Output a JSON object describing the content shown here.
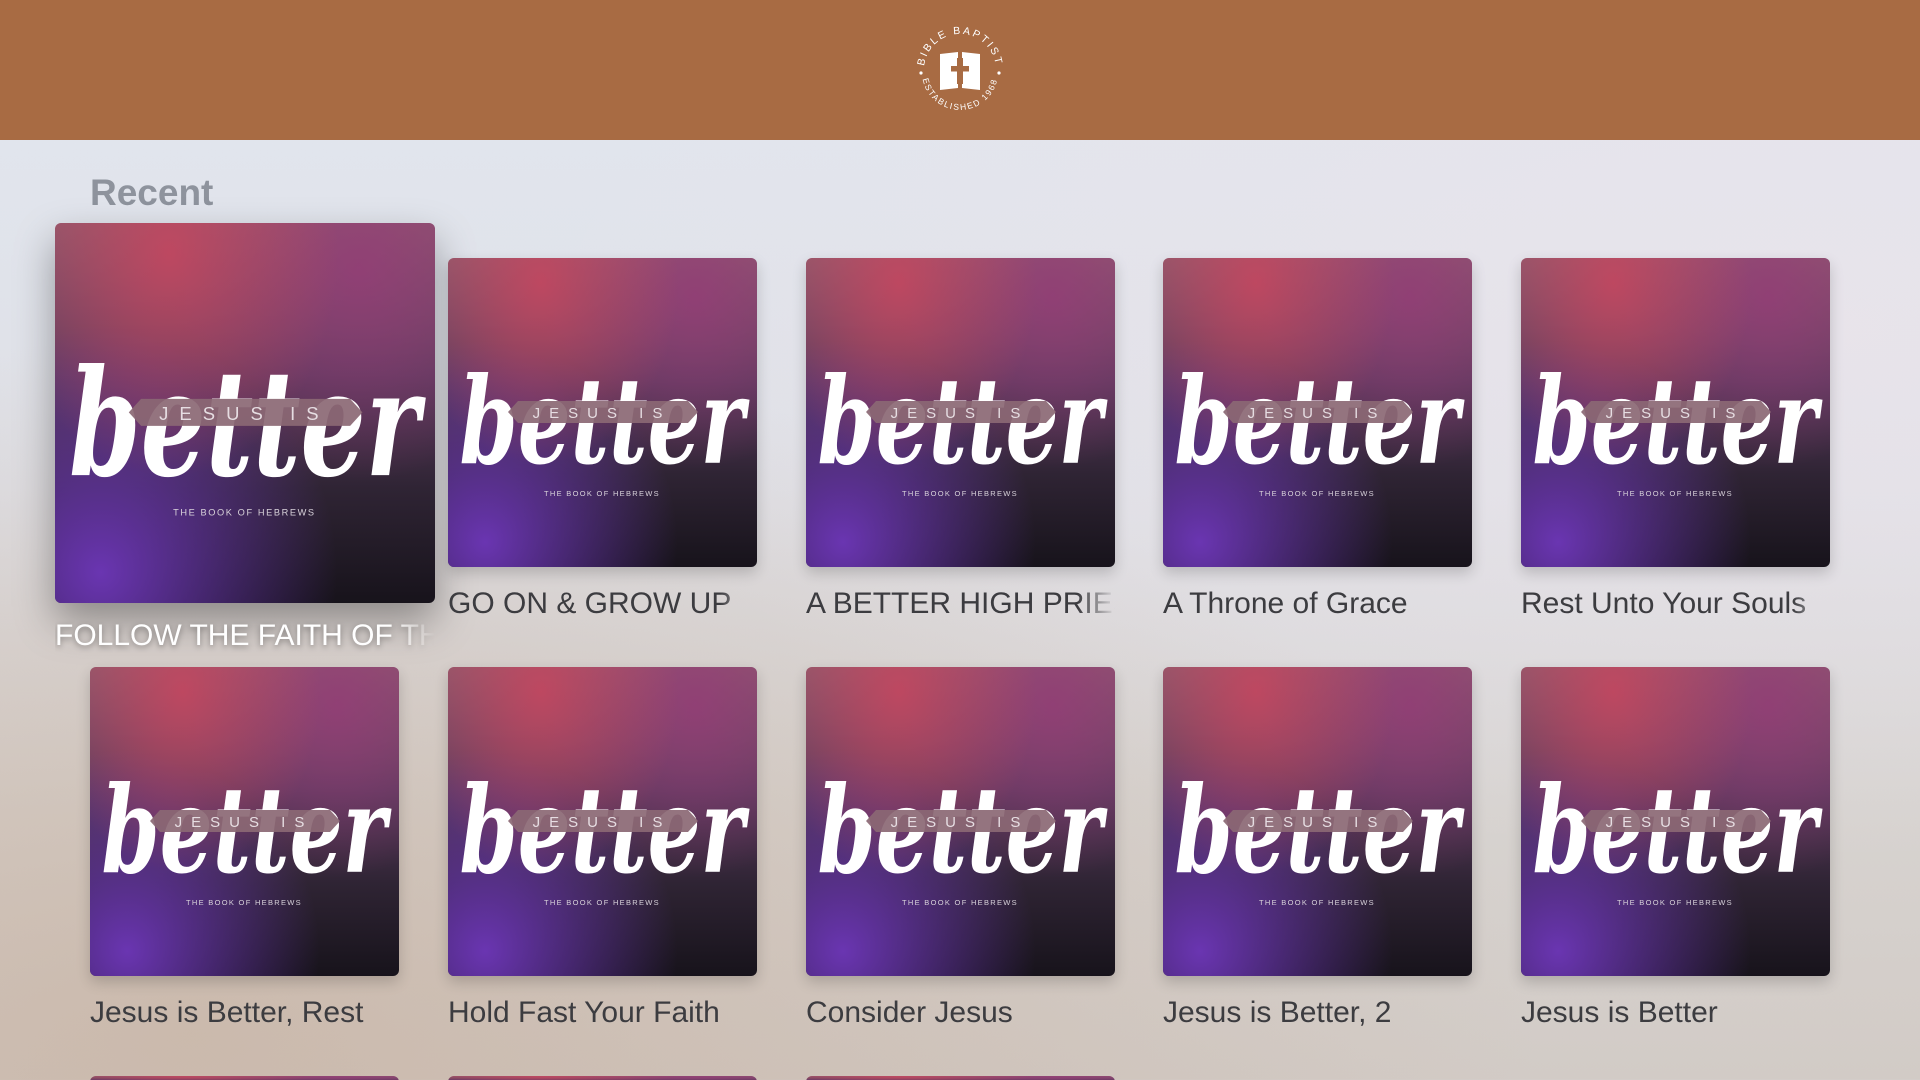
{
  "header": {
    "logo": {
      "icon": "bible-icon",
      "ring_top_text": "BIBLE BAPTIST",
      "ring_bottom_text": "ESTABLISHED 1968"
    },
    "background_color": "#a86b43"
  },
  "section": {
    "title": "Recent"
  },
  "artwork": {
    "script_word": "better",
    "banner_text": "JESUS IS",
    "subtitle": "THE BOOK OF HEBREWS"
  },
  "items": [
    {
      "title": "FOLLOW THE FAITH OF THEM",
      "focused": true
    },
    {
      "title": "GO ON & GROW UP"
    },
    {
      "title": "A BETTER HIGH PRIEST"
    },
    {
      "title": "A Throne of Grace"
    },
    {
      "title": "Rest Unto Your Souls"
    },
    {
      "title": "Jesus is Better, Rest"
    },
    {
      "title": "Hold Fast Your Faith"
    },
    {
      "title": "Consider Jesus"
    },
    {
      "title": "Jesus is Better, 2"
    },
    {
      "title": "Jesus is Better"
    }
  ]
}
